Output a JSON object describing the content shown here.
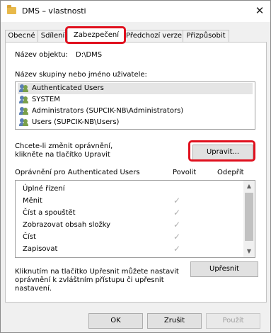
{
  "window": {
    "title": "DMS – vlastnosti",
    "close_glyph": "✕"
  },
  "tabs": [
    {
      "label": "Obecné"
    },
    {
      "label": "Sdílení"
    },
    {
      "label": "Zabezpečení",
      "active": true
    },
    {
      "label": "Předchozí verze"
    },
    {
      "label": "Přizpůsobit"
    }
  ],
  "object": {
    "label": "Název objektu:",
    "value": "D:\\DMS"
  },
  "groups": {
    "label": "Název skupiny nebo jméno uživatele:",
    "items": [
      {
        "name": "Authenticated Users",
        "icon": "users-icon",
        "selected": true
      },
      {
        "name": "SYSTEM",
        "icon": "users-icon"
      },
      {
        "name": "Administrators (SUPCIK-NB\\Administrators)",
        "icon": "users-icon"
      },
      {
        "name": "Users (SUPCIK-NB\\Users)",
        "icon": "users-icon"
      }
    ]
  },
  "edit": {
    "hint_line1": "Chcete-li změnit oprávnění,",
    "hint_line2": "klikněte na tlačítko Upravit",
    "button": "Upravit..."
  },
  "permissions": {
    "title": "Oprávnění pro Authenticated Users",
    "allow_header": "Povolit",
    "deny_header": "Odepřít",
    "check_glyph": "✓",
    "items": [
      {
        "name": "Úplné řízení",
        "allow": false,
        "deny": false
      },
      {
        "name": "Měnit",
        "allow": true,
        "deny": false
      },
      {
        "name": "Číst a spouštět",
        "allow": true,
        "deny": false
      },
      {
        "name": "Zobrazovat obsah složky",
        "allow": true,
        "deny": false
      },
      {
        "name": "Číst",
        "allow": true,
        "deny": false
      },
      {
        "name": "Zapisovat",
        "allow": true,
        "deny": false
      }
    ]
  },
  "advanced": {
    "hint_line1": "Kliknutím na tlačítko Upřesnit můžete nastavit",
    "hint_line2": "oprávnění k zvláštním přístupu či upřesnit",
    "hint_line3": "nastavení.",
    "button": "Upřesnit"
  },
  "footer": {
    "ok": "OK",
    "cancel": "Zrušit",
    "apply": "Použít"
  },
  "colors": {
    "highlight": "#e0101e",
    "selected_row": "#e5e5e5"
  }
}
